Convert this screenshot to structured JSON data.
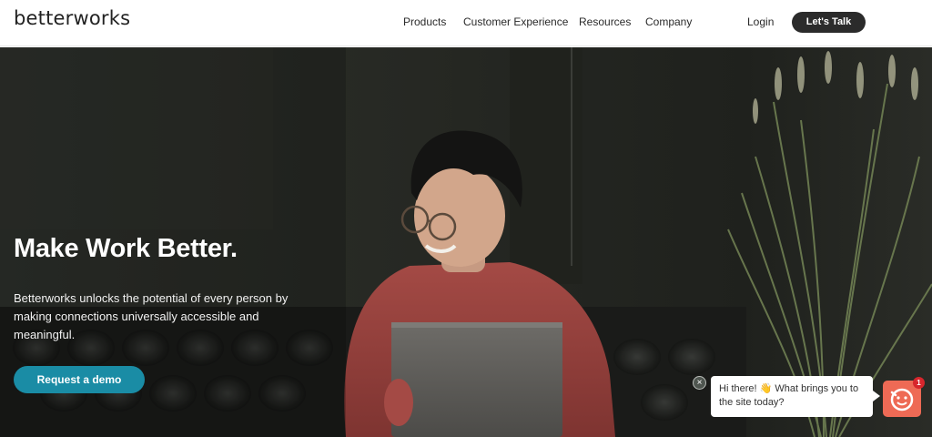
{
  "header": {
    "logo": "betterworks",
    "nav": {
      "products": "Products",
      "customer_experience": "Customer Experience",
      "resources": "Resources",
      "company": "Company",
      "login": "Login"
    },
    "cta": "Let's Talk"
  },
  "hero": {
    "title": "Make Work Better.",
    "description": "Betterworks unlocks the potential of every person by making connections universally accessible and meaningful.",
    "button": "Request a demo"
  },
  "chat": {
    "message": "Hi there! 👋 What brings you to the site today?",
    "close_glyph": "×",
    "badge_count": "1"
  },
  "colors": {
    "accent_teal": "#1a8ca5",
    "cta_dark": "#2b2b2b",
    "chat_orange": "#ee6a55",
    "badge_red": "#d7262c"
  }
}
